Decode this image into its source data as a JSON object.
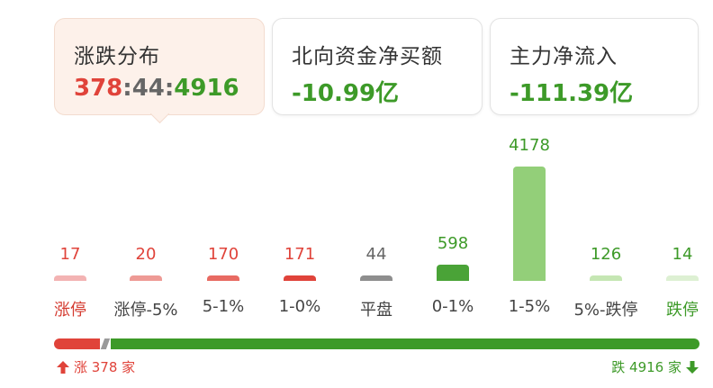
{
  "cards": [
    {
      "title": "涨跌分布",
      "rise": "378",
      "sep": ":",
      "flat": "44",
      "fall": "4916"
    },
    {
      "title": "北向资金净买额",
      "value": "-10.99亿"
    },
    {
      "title": "主力净流入",
      "value": "-111.39亿"
    }
  ],
  "distribution": [
    {
      "count": "17",
      "label": "涨停",
      "bar_color": "#f3b3b3",
      "num_color": "#e0433a",
      "label_color": "#d43a2f"
    },
    {
      "count": "20",
      "label": "涨停-5%",
      "bar_color": "#ee9a95",
      "num_color": "#e0433a",
      "label_color": "#444444"
    },
    {
      "count": "170",
      "label": "5-1%",
      "bar_color": "#e86a62",
      "num_color": "#e0433a",
      "label_color": "#444444"
    },
    {
      "count": "171",
      "label": "1-0%",
      "bar_color": "#e0433a",
      "num_color": "#e0433a",
      "label_color": "#444444"
    },
    {
      "count": "44",
      "label": "平盘",
      "bar_color": "#8e8e8e",
      "num_color": "#666666",
      "label_color": "#444444"
    },
    {
      "count": "598",
      "label": "0-1%",
      "bar_color": "#4aa337",
      "num_color": "#3d9a28",
      "label_color": "#444444"
    },
    {
      "count": "4178",
      "label": "1-5%",
      "bar_color": "#93cf79",
      "num_color": "#3d9a28",
      "label_color": "#444444"
    },
    {
      "count": "126",
      "label": "5%-跌停",
      "bar_color": "#c5e6b3",
      "num_color": "#3d9a28",
      "label_color": "#444444"
    },
    {
      "count": "14",
      "label": "跌停",
      "bar_color": "#ddf0d3",
      "num_color": "#3d9a28",
      "label_color": "#3d9a28"
    }
  ],
  "footer": {
    "up_text": "涨 378 家",
    "down_text": "跌 4916 家"
  }
}
